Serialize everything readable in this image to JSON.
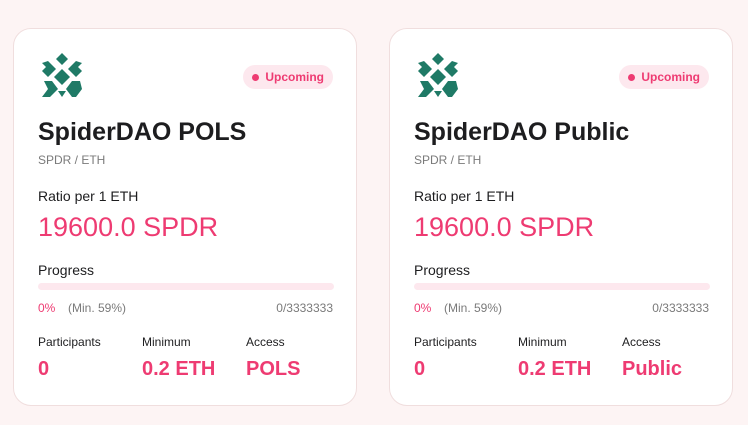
{
  "colors": {
    "accent": "#ee3b72",
    "logo": "#1f7a66",
    "badge_bg": "#fde8ee"
  },
  "cards": [
    {
      "logo_icon": "spiderdao-logo-icon",
      "status": "Upcoming",
      "title": "SpiderDAO POLS",
      "pair": "SPDR / ETH",
      "ratio_label": "Ratio per 1 ETH",
      "ratio_value": "19600.0 SPDR",
      "progress_label": "Progress",
      "progress_fraction": 0,
      "progress_percent": "0%",
      "progress_min": "(Min. 59%)",
      "progress_cap": "0/3333333",
      "stats": [
        {
          "label": "Participants",
          "value": "0"
        },
        {
          "label": "Minimum",
          "value": "0.2 ETH"
        },
        {
          "label": "Access",
          "value": "POLS"
        }
      ]
    },
    {
      "logo_icon": "spiderdao-logo-icon",
      "status": "Upcoming",
      "title": "SpiderDAO Public",
      "pair": "SPDR / ETH",
      "ratio_label": "Ratio per 1 ETH",
      "ratio_value": "19600.0 SPDR",
      "progress_label": "Progress",
      "progress_fraction": 0,
      "progress_percent": "0%",
      "progress_min": "(Min. 59%)",
      "progress_cap": "0/3333333",
      "stats": [
        {
          "label": "Participants",
          "value": "0"
        },
        {
          "label": "Minimum",
          "value": "0.2 ETH"
        },
        {
          "label": "Access",
          "value": "Public"
        }
      ]
    }
  ]
}
